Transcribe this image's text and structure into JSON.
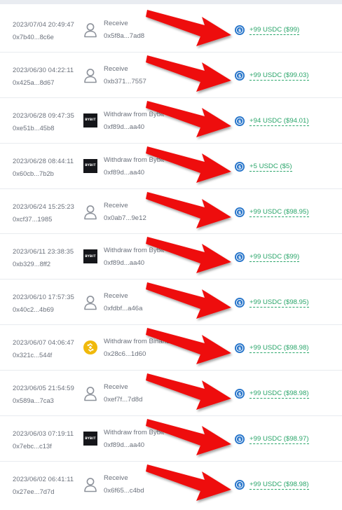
{
  "transactions": [
    {
      "date": "2023/07/04 20:49:47",
      "hash": "0x7b40...8c6e",
      "type": "user",
      "label": "Receive",
      "address": "0x5f8a...7ad8",
      "amount": "+99 USDC ($99)"
    },
    {
      "date": "2023/06/30 04:22:11",
      "hash": "0x425a...8d67",
      "type": "user",
      "label": "Receive",
      "address": "0xb371...7557",
      "amount": "+99 USDC ($99.03)"
    },
    {
      "date": "2023/06/28 09:47:35",
      "hash": "0xe51b...45b8",
      "type": "bybit",
      "label": "Withdraw from Bybit",
      "address": "0xf89d...aa40",
      "amount": "+94 USDC ($94.01)"
    },
    {
      "date": "2023/06/28 08:44:11",
      "hash": "0x60cb...7b2b",
      "type": "bybit",
      "label": "Withdraw from Bybit",
      "address": "0xf89d...aa40",
      "amount": "+5 USDC ($5)"
    },
    {
      "date": "2023/06/24 15:25:23",
      "hash": "0xcf37...1985",
      "type": "user",
      "label": "Receive",
      "address": "0x0ab7...9e12",
      "amount": "+99 USDC ($98.95)"
    },
    {
      "date": "2023/06/11 23:38:35",
      "hash": "0xb329...8ff2",
      "type": "bybit",
      "label": "Withdraw from Bybit",
      "address": "0xf89d...aa40",
      "amount": "+99 USDC ($99)"
    },
    {
      "date": "2023/06/10 17:57:35",
      "hash": "0x40c2...4b69",
      "type": "user",
      "label": "Receive",
      "address": "0xfdbf...a46a",
      "amount": "+99 USDC ($98.95)"
    },
    {
      "date": "2023/06/07 04:06:47",
      "hash": "0x321c...544f",
      "type": "binance",
      "label": "Withdraw from Binance",
      "address": "0x28c6...1d60",
      "amount": "+99 USDC ($98.98)"
    },
    {
      "date": "2023/06/05 21:54:59",
      "hash": "0x589a...7ca3",
      "type": "user",
      "label": "Receive",
      "address": "0xef7f...7d8d",
      "amount": "+99 USDC ($98.98)"
    },
    {
      "date": "2023/06/03 07:19:11",
      "hash": "0x7ebc...c13f",
      "type": "bybit",
      "label": "Withdraw from Bybit",
      "address": "0xf89d...aa40",
      "amount": "+99 USDC ($98.97)"
    },
    {
      "date": "2023/06/02 06:41:11",
      "hash": "0x27ee...7d7d",
      "type": "user",
      "label": "Receive",
      "address": "0x6f65...c4bd",
      "amount": "+99 USDC ($98.98)"
    }
  ],
  "bybit_logo_text": "BYBIT",
  "colors": {
    "amount": "#2aa56a",
    "arrow": "#ee1111",
    "usdc": "#2775ca"
  }
}
